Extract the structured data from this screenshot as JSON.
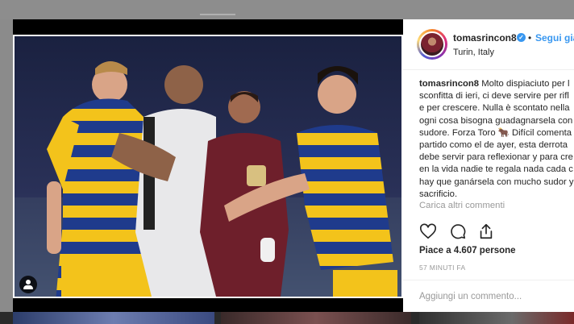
{
  "post": {
    "username": "tomasrincon8",
    "verified_icon": "verified-badge-icon",
    "separator": "•",
    "follow_label": "Segui già",
    "location": "Turin, Italy",
    "caption_user": "tomasrincon8",
    "caption_lines": [
      "Molto dispiaciuto per l",
      "sconfitta di ieri, ci deve servire per rifl",
      "e per crescere. Nulla è scontato nella",
      "ogni cosa bisogna guadagnarsela con",
      "sudore. Forza Toro 🐂 Difícil comenta",
      "partido como el de ayer, esta derrota",
      "debe servir para reflexionar y para cre",
      "en la vida nadie te regala nada cada c",
      "hay que ganársela con mucho sudor y",
      "sacrificio."
    ],
    "load_more": "Carica altri commenti",
    "likes": "Piace a 4.607 persone",
    "time": "57 MINUTI FA",
    "comment_placeholder": "Aggiungi un commento..."
  },
  "colors": {
    "accent": "#3897f0",
    "text": "#262626",
    "muted": "#999999",
    "parma_yellow": "#f3c31b",
    "parma_blue": "#1f3b8c",
    "torino_granata": "#6e1f2b"
  }
}
